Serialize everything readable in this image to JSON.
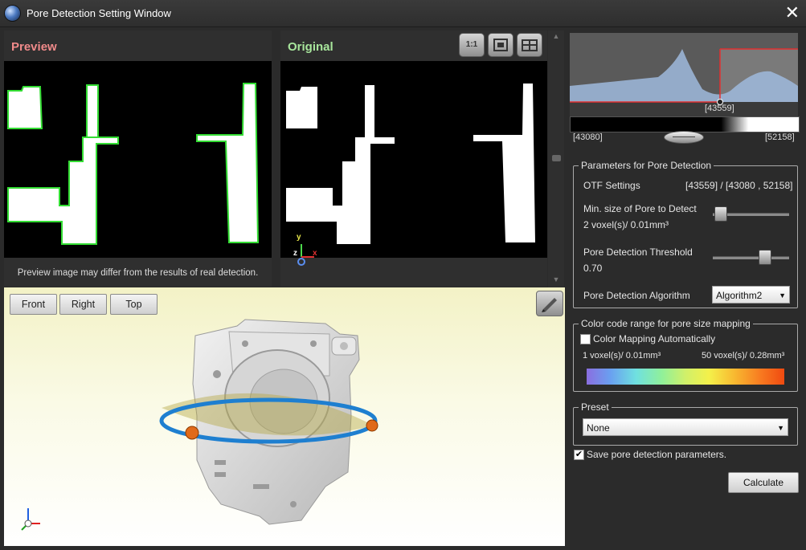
{
  "window": {
    "title": "Pore Detection Setting Window"
  },
  "preview": {
    "title": "Preview",
    "caption": "Preview image may differ from the results of real detection."
  },
  "original": {
    "title": "Original",
    "tool_1to1_label": "1:1",
    "axis_y": "y",
    "axis_z": "z",
    "axis_x": "x"
  },
  "viewer": {
    "buttons": [
      "Front",
      "Right",
      "Top"
    ]
  },
  "histogram": {
    "marker_value": "[43559]",
    "min_label": "[43080]",
    "max_label": "[52158]"
  },
  "params": {
    "group_title": "Parameters for Pore Detection",
    "otf_label": "OTF Settings",
    "otf_value": "[43559] / [43080 , 52158]",
    "min_size_label": "Min. size of Pore to Detect",
    "min_size_value": "2 voxel(s)/ 0.01mm³",
    "min_size_level": 0.03,
    "threshold_label": "Pore Detection Threshold",
    "threshold_value": "0.70",
    "threshold_level": 0.7,
    "algorithm_label": "Pore Detection Algorithm",
    "algorithm_value": "Algorithm2"
  },
  "colorcode": {
    "group_title": "Color code range for pore size mapping",
    "auto_label": "Color Mapping Automatically",
    "auto_checked": false,
    "min_label": "1 voxel(s)/ 0.01mm³",
    "max_label": "50 voxel(s)/ 0.28mm³"
  },
  "preset": {
    "group_title": "Preset",
    "value": "None"
  },
  "save": {
    "label": "Save pore detection parameters.",
    "checked": true
  },
  "calculate_label": "Calculate",
  "colors": {
    "preview_title": "#f08a8a",
    "original_title": "#a8e69c",
    "outline_green": "#33dd33"
  }
}
